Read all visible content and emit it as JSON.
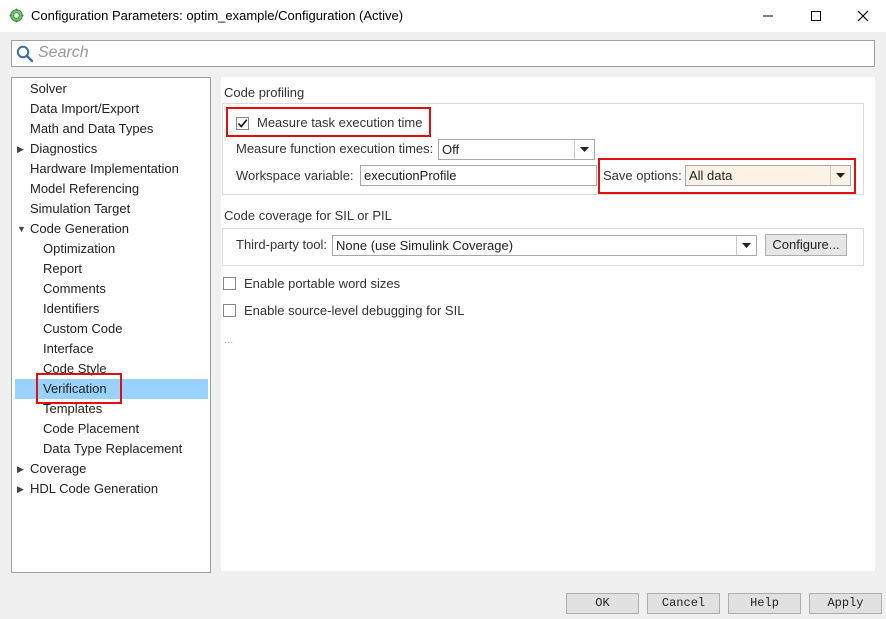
{
  "window": {
    "title": "Configuration Parameters: optim_example/Configuration (Active)",
    "icons": [
      "app-gear-icon",
      "minimize-icon",
      "maximize-icon",
      "close-icon"
    ]
  },
  "search": {
    "placeholder": "Search",
    "value": ""
  },
  "tree": {
    "items": [
      {
        "label": "Solver",
        "level": 0,
        "expandable": false
      },
      {
        "label": "Data Import/Export",
        "level": 0,
        "expandable": false
      },
      {
        "label": "Math and Data Types",
        "level": 0,
        "expandable": false
      },
      {
        "label": "Diagnostics",
        "level": 0,
        "expandable": true,
        "expanded": false
      },
      {
        "label": "Hardware Implementation",
        "level": 0,
        "expandable": false
      },
      {
        "label": "Model Referencing",
        "level": 0,
        "expandable": false
      },
      {
        "label": "Simulation Target",
        "level": 0,
        "expandable": false
      },
      {
        "label": "Code Generation",
        "level": 0,
        "expandable": true,
        "expanded": true
      },
      {
        "label": "Optimization",
        "level": 1
      },
      {
        "label": "Report",
        "level": 1
      },
      {
        "label": "Comments",
        "level": 1
      },
      {
        "label": "Identifiers",
        "level": 1
      },
      {
        "label": "Custom Code",
        "level": 1
      },
      {
        "label": "Interface",
        "level": 1
      },
      {
        "label": "Code Style",
        "level": 1
      },
      {
        "label": "Verification",
        "level": 1,
        "selected": true
      },
      {
        "label": "Templates",
        "level": 1
      },
      {
        "label": "Code Placement",
        "level": 1
      },
      {
        "label": "Data Type Replacement",
        "level": 1
      },
      {
        "label": "Coverage",
        "level": 0,
        "expandable": true,
        "expanded": false
      },
      {
        "label": "HDL Code Generation",
        "level": 0,
        "expandable": true,
        "expanded": false
      }
    ]
  },
  "profiling": {
    "section_title": "Code profiling",
    "measure_task_label": "Measure task execution time",
    "measure_task_checked": true,
    "measure_function_label": "Measure function execution times:",
    "measure_function_value": "Off",
    "workspace_label": "Workspace variable:",
    "workspace_value": "executionProfile",
    "save_options_label": "Save options:",
    "save_options_value": "All data"
  },
  "coverage": {
    "section_title": "Code coverage for SIL or PIL",
    "third_party_label": "Third-party tool:",
    "third_party_value": "None (use Simulink Coverage)",
    "configure_label": "Configure..."
  },
  "options": {
    "portable_word_label": "Enable portable word sizes",
    "portable_word_checked": false,
    "source_debug_label": "Enable source-level debugging for SIL",
    "source_debug_checked": false,
    "more_indicator": "..."
  },
  "footer": {
    "ok_label": "OK",
    "cancel_label": "Cancel",
    "help_label": "Help",
    "apply_label": "Apply"
  },
  "colors": {
    "highlight_red": "#e01010",
    "selection_blue": "#99d1ff",
    "save_options_bg": "#fdf2e6"
  }
}
